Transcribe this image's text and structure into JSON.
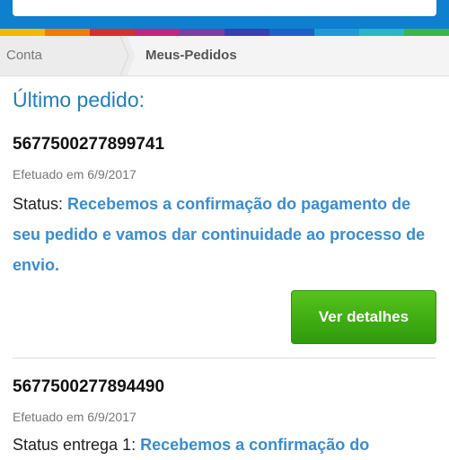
{
  "search": {
    "icon": "search-icon"
  },
  "colors": {
    "header_bg": "#0f7fd0",
    "accent_blue": "#1f7fbf",
    "status_blue": "#3a8dd0",
    "button_green": "#3fae14",
    "strip": [
      "#f5b800",
      "#f27c00",
      "#d6302a",
      "#c1257c",
      "#7a3fa0",
      "#3a3fb0",
      "#1f5fc8",
      "#1f9ad6",
      "#29b6c8",
      "#3bb54a"
    ]
  },
  "breadcrumb": {
    "items": [
      "Conta",
      "Meus-Pedidos"
    ]
  },
  "main": {
    "section_title": "Último pedido:",
    "orders": [
      {
        "number": "5677500277899741",
        "date": "Efetuado em 6/9/2017",
        "status_label": "Status:",
        "status_message": "Recebemos a confirmação do pagamento de seu pedido e vamos dar continuidade ao processo de envio.",
        "button_label": "Ver detalhes"
      },
      {
        "number": "5677500277894490",
        "date": "Efetuado em 6/9/2017",
        "status_label": "Status entrega 1:",
        "status_message": "Recebemos a confirmação do"
      }
    ]
  }
}
